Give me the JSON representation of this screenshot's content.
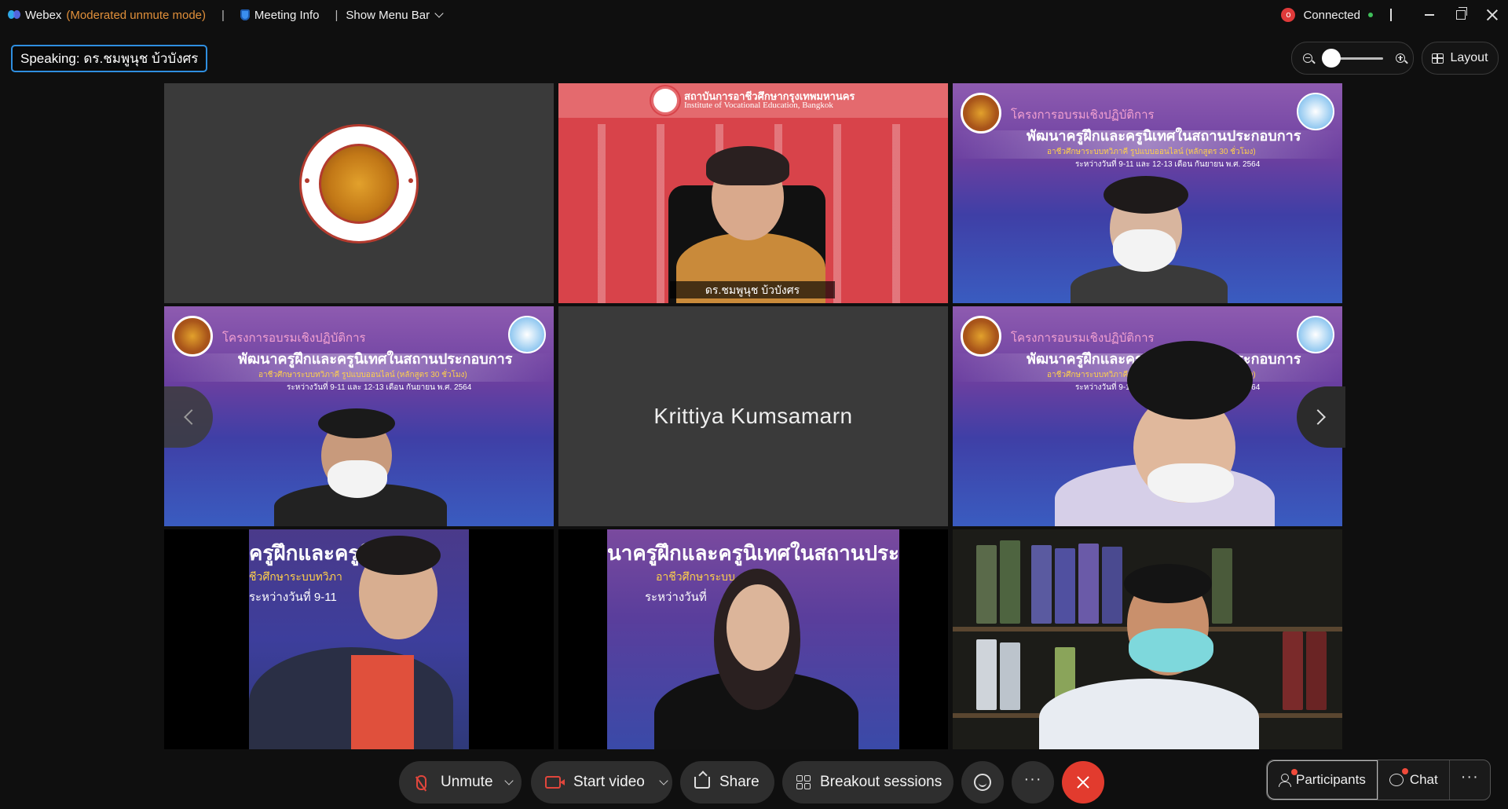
{
  "titlebar": {
    "app_name": "Webex",
    "mode": "(Moderated unmute mode)",
    "separator": "|",
    "meeting_info": "Meeting Info",
    "menu_bar": "Show Menu Bar",
    "rec_icon_text": "o",
    "status": "Connected",
    "status_color": "#3fbf5a"
  },
  "speaking_label": "Speaking: ดร.ชมพูนุช บ้วบังศร",
  "layout_button": "Layout",
  "tiles": {
    "t2": {
      "caption": "ดร.ชมพูนุช บ้วบังศร",
      "inst_line1": "สถาบันการอาชีวศึกษากรุงเทพมหานคร",
      "inst_line2": "Institute of Vocational Education, Bangkok"
    },
    "banner": {
      "line1": "โครงการอบรมเชิงปฏิบัติการ",
      "line2": "พัฒนาครูฝึกและครูนิเทศในสถานประกอบการ",
      "line3": "อาชีวศึกษาระบบทวิภาคี รูปแบบออนไลน์ (หลักสูตร 30 ชั่วโมง)",
      "line4": "ระหว่างวันที่ 9-11 และ 12-13 เดือน กันยายน พ.ศ. 2564"
    },
    "t5": {
      "name": "Krittiya Kumsamarn"
    },
    "t7": {
      "line1": "ครูฝึกและครูนิ",
      "line2": "ชีวศึกษาระบบทวิภา",
      "line3": "ระหว่างวันที่ 9-11"
    },
    "t8": {
      "line1": "นาครูฝึกและครูนิเทศในสถานประก",
      "line2": "อาชีวศึกษาระบบ",
      "line3": "ระหว่างวันที่"
    }
  },
  "controls": {
    "unmute": "Unmute",
    "start_video": "Start video",
    "share": "Share",
    "breakout": "Breakout sessions",
    "more": "···",
    "participants": "Participants",
    "chat": "Chat",
    "more_right": "···",
    "end_color": "#e23b2e",
    "accent": "#29b6e8"
  }
}
